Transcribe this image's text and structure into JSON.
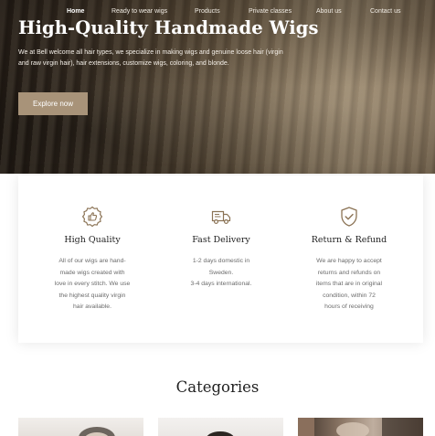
{
  "nav": {
    "items": [
      {
        "label": "Home",
        "active": true
      },
      {
        "label": "Ready to wear wigs"
      },
      {
        "label": "Products"
      },
      {
        "label": "Private classes"
      },
      {
        "label": "About us"
      },
      {
        "label": "Contact us"
      }
    ]
  },
  "hero": {
    "title": "High-Quality Handmade Wigs",
    "description": "We at Bell welcome all hair types, we specialize in making wigs and genuine loose hair (virgin and raw virgin hair), hair extensions, customize wigs, coloring, and blonde.",
    "button_label": "Explore now"
  },
  "features": [
    {
      "icon": "badge-thumbs-up-icon",
      "title": "High Quality",
      "lines": [
        "All of our wigs are hand-",
        "made wigs created with",
        "love in every stitch. We use",
        "the highest quality virgin",
        "hair available."
      ]
    },
    {
      "icon": "delivery-truck-icon",
      "title": "Fast Delivery",
      "lines": [
        "1-2 days domestic in",
        "Sweden.",
        "3-4 days international."
      ]
    },
    {
      "icon": "shield-check-icon",
      "title": "Return & Refund",
      "lines": [
        "We are happy to accept",
        "returns and refunds on",
        "items that are in original",
        "condition, within 72",
        "hours of receiving"
      ]
    }
  ],
  "categories": {
    "title": "Categories"
  },
  "colors": {
    "accent": "#a89379",
    "icon": "#8b7355"
  }
}
